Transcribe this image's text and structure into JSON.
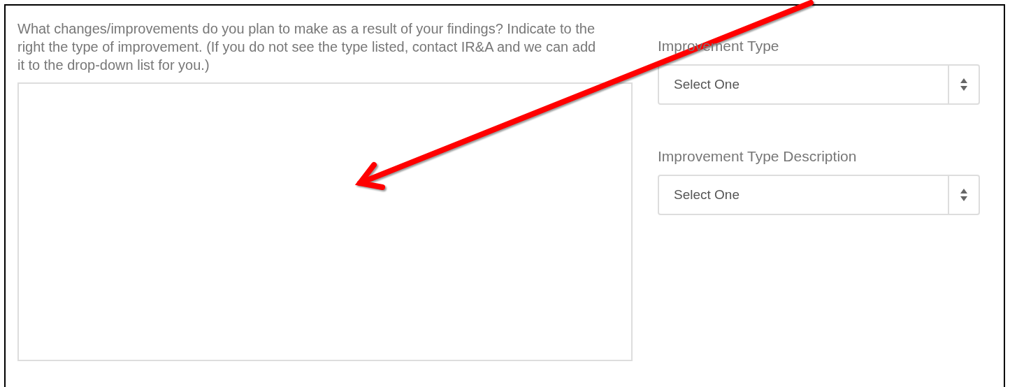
{
  "question": {
    "text": "What changes/improvements do you plan to make as a result of your findings? Indicate to the right the type of improvement. (If you do not see the type listed, contact IR&A and we can add it to the drop-down list for you.)"
  },
  "fields": [
    {
      "label": "Improvement Type",
      "value": "Select One"
    },
    {
      "label": "Improvement Type Description",
      "value": "Select One"
    }
  ]
}
